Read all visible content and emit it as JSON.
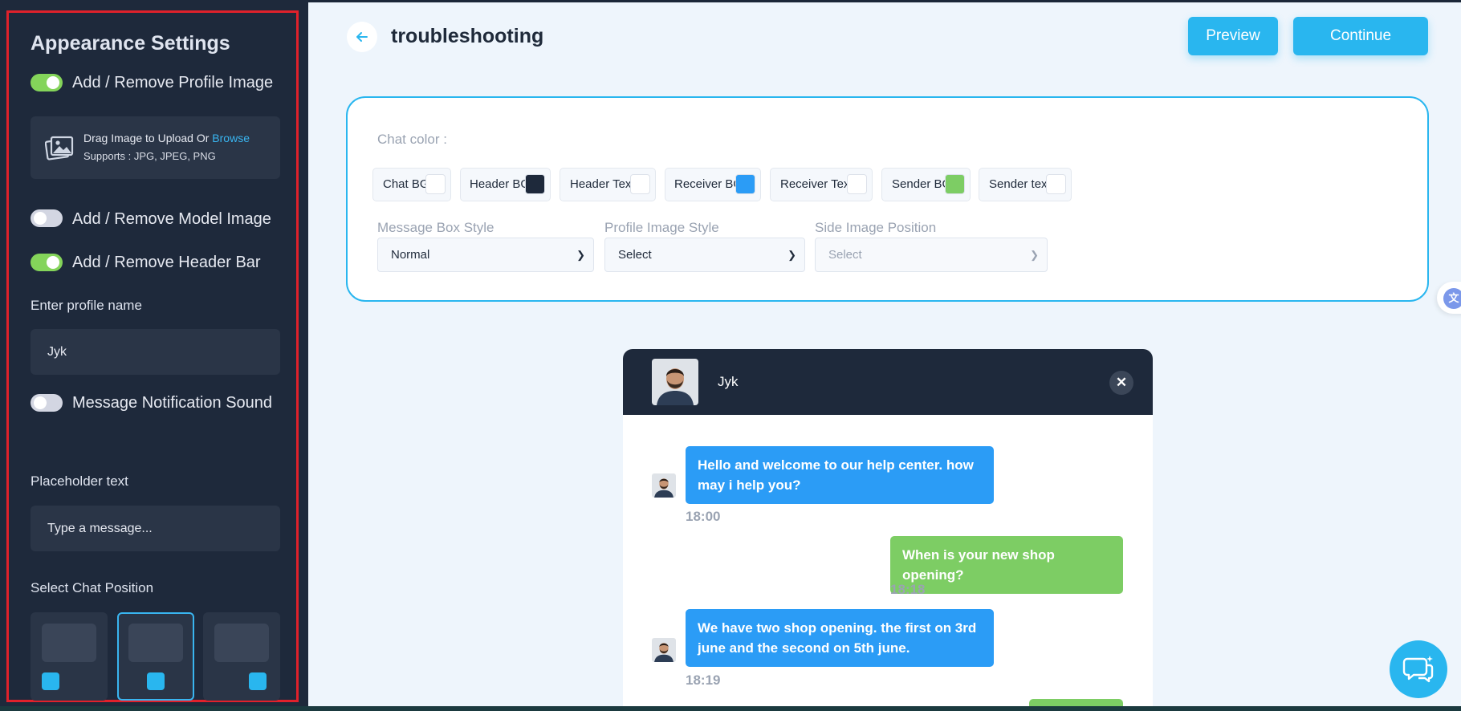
{
  "sidebar": {
    "title": "Appearance Settings",
    "toggles": {
      "profile_image": {
        "label": "Add / Remove Profile Image",
        "on": true
      },
      "model_image": {
        "label": "Add / Remove Model Image",
        "on": false
      },
      "header_bar": {
        "label": "Add / Remove Header Bar",
        "on": true
      },
      "notification_sound": {
        "label": "Message Notification Sound",
        "on": false
      }
    },
    "upload": {
      "text": "Drag Image to Upload Or ",
      "browse": "Browse",
      "supports": "Supports : JPG, JPEG, PNG"
    },
    "profile_name": {
      "label": "Enter profile name",
      "value": "Jyk"
    },
    "placeholder": {
      "label": "Placeholder text",
      "value": "Type a message..."
    },
    "chat_position": {
      "label": "Select Chat Position",
      "selected_index": 1
    }
  },
  "header": {
    "title": "troubleshooting",
    "back_icon": "arrow-left-icon",
    "preview_label": "Preview",
    "continue_label": "Continue"
  },
  "settings": {
    "chat_color_label": "Chat color :",
    "colors": [
      {
        "label": "Chat BG",
        "color": "#ffffff"
      },
      {
        "label": "Header BG",
        "color": "#1e293b"
      },
      {
        "label": "Header Text",
        "color": "#ffffff"
      },
      {
        "label": "Receiver BG",
        "color": "#2b9cf6"
      },
      {
        "label": "Receiver Text",
        "color": "#ffffff"
      },
      {
        "label": "Sender BG",
        "color": "#7dcd64"
      },
      {
        "label": "Sender text",
        "color": "#ffffff"
      }
    ],
    "message_box_style": {
      "label": "Message Box Style",
      "value": "Normal"
    },
    "profile_image_style": {
      "label": "Profile Image Style",
      "value": "Select"
    },
    "side_image_position": {
      "label": "Side Image Position",
      "value": "Select"
    }
  },
  "chat": {
    "name": "Jyk",
    "messages": [
      {
        "type": "received",
        "text": "Hello and welcome to our help center. how may i help you?",
        "time": "18:00"
      },
      {
        "type": "sent",
        "text": "When is your new shop opening?",
        "time": "18:18"
      },
      {
        "type": "received",
        "text": "We have two shop opening. the first on 3rd june and the second on 5th june.",
        "time": "18:19"
      }
    ]
  },
  "colors": {
    "accent": "#29b6ef",
    "sidebar_bg": "#1e293b",
    "toggle_on": "#84d45a",
    "highlight_frame": "#e0212b"
  }
}
